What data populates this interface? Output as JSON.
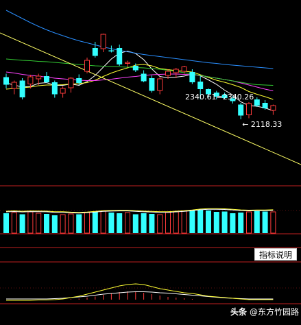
{
  "labels": {
    "ma_readout": "2340.61=2340.26",
    "low_price": "← 2118.33",
    "indicator_button": "指标说明"
  },
  "watermark": {
    "platform": "头条",
    "separator": "@",
    "author": "东方竹园路"
  },
  "colors": {
    "background": "#000000",
    "up": "#ff3b3b",
    "down": "#33ffff",
    "grid": "#c02020",
    "ma5": "#ffffff",
    "ma10": "#ffff33",
    "ma20": "#ff44ff",
    "ma30": "#33cc33",
    "ma60": "#2a8fff",
    "trendline": "#ffff66"
  },
  "chart_data": {
    "type": "candlestick",
    "price_range": [
      2080,
      2620
    ],
    "candles": [
      {
        "o": 2395,
        "h": 2405,
        "l": 2362,
        "c": 2373
      },
      {
        "o": 2362,
        "h": 2385,
        "l": 2345,
        "c": 2380
      },
      {
        "o": 2385,
        "h": 2392,
        "l": 2330,
        "c": 2336
      },
      {
        "o": 2375,
        "h": 2402,
        "l": 2362,
        "c": 2396
      },
      {
        "o": 2390,
        "h": 2405,
        "l": 2372,
        "c": 2398
      },
      {
        "o": 2398,
        "h": 2410,
        "l": 2378,
        "c": 2380
      },
      {
        "o": 2380,
        "h": 2385,
        "l": 2335,
        "c": 2345
      },
      {
        "o": 2348,
        "h": 2368,
        "l": 2335,
        "c": 2362
      },
      {
        "o": 2364,
        "h": 2395,
        "l": 2350,
        "c": 2392
      },
      {
        "o": 2392,
        "h": 2403,
        "l": 2372,
        "c": 2378
      },
      {
        "o": 2412,
        "h": 2452,
        "l": 2406,
        "c": 2444
      },
      {
        "o": 2480,
        "h": 2498,
        "l": 2452,
        "c": 2457
      },
      {
        "o": 2478,
        "h": 2522,
        "l": 2468,
        "c": 2520
      },
      {
        "o": 2473,
        "h": 2487,
        "l": 2467,
        "c": 2470
      },
      {
        "o": 2480,
        "h": 2490,
        "l": 2428,
        "c": 2432
      },
      {
        "o": 2435,
        "h": 2443,
        "l": 2425,
        "c": 2438
      },
      {
        "o": 2428,
        "h": 2435,
        "l": 2410,
        "c": 2415
      },
      {
        "o": 2405,
        "h": 2415,
        "l": 2380,
        "c": 2383
      },
      {
        "o": 2392,
        "h": 2400,
        "l": 2350,
        "c": 2355
      },
      {
        "o": 2356,
        "h": 2395,
        "l": 2345,
        "c": 2390
      },
      {
        "o": 2400,
        "h": 2418,
        "l": 2390,
        "c": 2412
      },
      {
        "o": 2408,
        "h": 2422,
        "l": 2392,
        "c": 2418
      },
      {
        "o": 2412,
        "h": 2428,
        "l": 2405,
        "c": 2425
      },
      {
        "o": 2410,
        "h": 2418,
        "l": 2375,
        "c": 2380
      },
      {
        "o": 2382,
        "h": 2398,
        "l": 2330,
        "c": 2360
      },
      {
        "o": 2360,
        "h": 2362,
        "l": 2335,
        "c": 2345
      },
      {
        "o": 2350,
        "h": 2355,
        "l": 2330,
        "c": 2338
      },
      {
        "o": 2344,
        "h": 2350,
        "l": 2330,
        "c": 2334
      },
      {
        "o": 2333,
        "h": 2340,
        "l": 2318,
        "c": 2325
      },
      {
        "o": 2315,
        "h": 2320,
        "l": 2272,
        "c": 2283
      },
      {
        "o": 2285,
        "h": 2322,
        "l": 2275,
        "c": 2318
      },
      {
        "o": 2330,
        "h": 2336,
        "l": 2308,
        "c": 2312
      },
      {
        "o": 2320,
        "h": 2328,
        "l": 2300,
        "c": 2304
      },
      {
        "o": 2298,
        "h": 2315,
        "l": 2285,
        "c": 2312
      }
    ],
    "ma": [
      {
        "name": "MA5",
        "color": "#ffffff",
        "values": [
          2378,
          2372,
          2366,
          2368,
          2377,
          2379,
          2371,
          2371,
          2375,
          2371,
          2382,
          2400,
          2424,
          2448,
          2465,
          2471,
          2464,
          2446,
          2419,
          2397,
          2393,
          2395,
          2398,
          2404,
          2399,
          2387,
          2374,
          2357,
          2343,
          2323,
          2312,
          2310,
          2305,
          2297
        ]
      },
      {
        "name": "MA10",
        "color": "#ffff33",
        "values": [
          2360,
          2362,
          2364,
          2366,
          2370,
          2372,
          2372,
          2373,
          2375,
          2376,
          2379,
          2386,
          2397,
          2407,
          2415,
          2422,
          2430,
          2432,
          2428,
          2420,
          2417,
          2414,
          2412,
          2410,
          2402,
          2394,
          2386,
          2380,
          2373,
          2365,
          2353,
          2345,
          2338,
          2330
        ]
      },
      {
        "name": "MA20",
        "color": "#ff44ff",
        "values": [
          2410,
          2407,
          2403,
          2400,
          2398,
          2395,
          2392,
          2390,
          2388,
          2386,
          2385,
          2385,
          2387,
          2389,
          2392,
          2395,
          2397,
          2400,
          2402,
          2403,
          2404,
          2404,
          2403,
          2402,
          2400,
          2396,
          2392,
          2388,
          2384,
          2378,
          2372,
          2366,
          2360,
          2355
        ]
      },
      {
        "name": "MA30",
        "color": "#33cc33",
        "values": [
          2448,
          2446,
          2444,
          2443,
          2441,
          2440,
          2438,
          2436,
          2434,
          2432,
          2430,
          2428,
          2427,
          2426,
          2425,
          2424,
          2423,
          2422,
          2420,
          2418,
          2415,
          2412,
          2408,
          2404,
          2400,
          2396,
          2392,
          2388,
          2384,
          2380,
          2376,
          2373,
          2372,
          2371
        ]
      },
      {
        "name": "MA60",
        "color": "#2a8fff",
        "values": [
          2590,
          2578,
          2566,
          2554,
          2543,
          2533,
          2524,
          2516,
          2508,
          2501,
          2495,
          2489,
          2483,
          2478,
          2473,
          2469,
          2465,
          2461,
          2458,
          2455,
          2452,
          2449,
          2446,
          2443,
          2440,
          2437,
          2435,
          2432,
          2430,
          2428,
          2426,
          2424,
          2422,
          2420
        ]
      }
    ],
    "volume": {
      "range": [
        0,
        100
      ],
      "values": [
        58,
        60,
        55,
        62,
        58,
        56,
        52,
        54,
        56,
        55,
        60,
        62,
        64,
        60,
        58,
        60,
        55,
        58,
        56,
        54,
        60,
        62,
        65,
        66,
        68,
        66,
        62,
        63,
        58,
        60,
        62,
        64,
        63,
        62
      ]
    },
    "indicator": {
      "range": [
        0,
        100
      ],
      "line1": [
        8,
        8,
        8,
        8,
        9,
        9,
        10,
        12,
        16,
        20,
        26,
        32,
        38,
        44,
        50,
        54,
        56,
        54,
        48,
        42,
        38,
        34,
        30,
        28,
        24,
        20,
        18,
        16,
        14,
        12,
        10,
        10,
        10,
        10
      ],
      "line2": [
        12,
        12,
        12,
        12,
        12,
        12,
        13,
        14,
        16,
        18,
        20,
        23,
        26,
        28,
        30,
        32,
        33,
        33,
        32,
        30,
        29,
        27,
        25,
        23,
        21,
        19,
        17,
        15,
        14,
        13,
        12,
        12,
        12,
        12
      ],
      "bars": [
        0,
        0,
        0,
        0,
        0,
        0,
        0,
        0,
        2,
        3,
        6,
        9,
        14,
        18,
        22,
        24,
        24,
        20,
        16,
        12,
        8,
        6,
        4,
        2,
        0,
        0,
        0,
        0,
        0,
        0,
        0,
        0,
        0,
        0
      ]
    }
  }
}
